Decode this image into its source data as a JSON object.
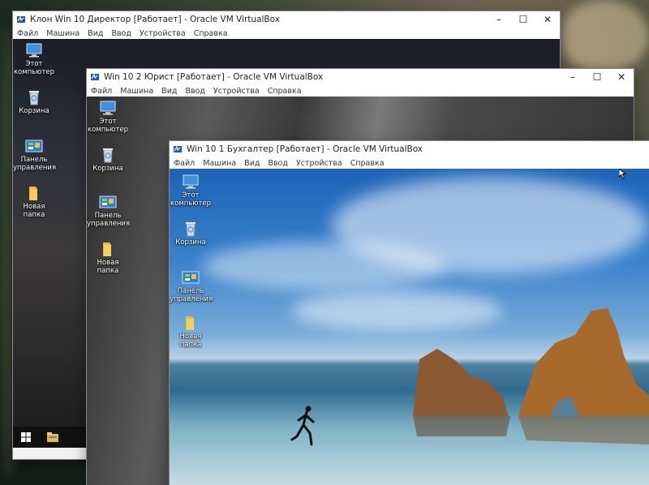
{
  "windows": [
    {
      "title": "Клон Win 10 Директор [Работает] - Oracle VM VirtualBox",
      "menu": [
        "Файл",
        "Машина",
        "Вид",
        "Ввод",
        "Устройства",
        "Справка"
      ],
      "icons": [
        "Этот компьютер",
        "Корзина",
        "Панель управления",
        "Новая папка"
      ]
    },
    {
      "title": "Win 10 2 Юрист [Работает] - Oracle VM VirtualBox",
      "menu": [
        "Файл",
        "Машина",
        "Вид",
        "Ввод",
        "Устройства",
        "Справка"
      ],
      "icons": [
        "Этот компьютер",
        "Корзина",
        "Панель управления",
        "Новая папка"
      ]
    },
    {
      "title": "Win 10 1 Бухгалтер [Работает] - Oracle VM VirtualBox",
      "menu": [
        "Файл",
        "Машина",
        "Вид",
        "Ввод",
        "Устройства",
        "Справка"
      ],
      "icons": [
        "Этот компьютер",
        "Корзина",
        "Панель управления",
        "Новая папка"
      ]
    }
  ],
  "icon_names": {
    "computer": "monitor-icon",
    "recycle": "recycle-bin-icon",
    "control": "control-panel-icon",
    "folder": "folder-icon",
    "start": "windows-start-icon",
    "explorer": "file-explorer-icon"
  },
  "colors": {
    "accent": "#0078d7",
    "titlebar": "#ffffff",
    "folder": "#e8b93c"
  }
}
